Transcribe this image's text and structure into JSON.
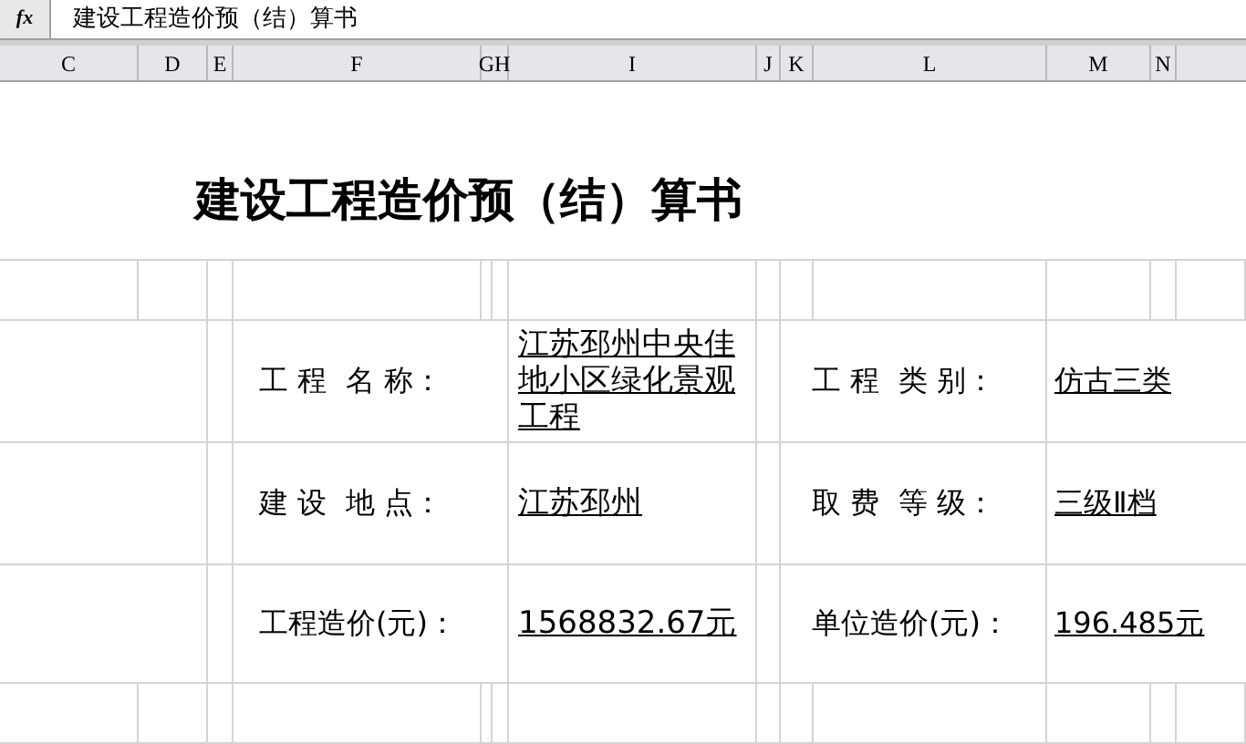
{
  "formula_bar": {
    "icon": "fx",
    "content": "建设工程造价预（结）算书"
  },
  "column_headers": [
    "C",
    "D",
    "E",
    "F",
    "GH",
    "I",
    "J",
    "K",
    "L",
    "M",
    "N"
  ],
  "title": "建设工程造价预（结）算书",
  "info_rows": [
    [
      {
        "label": "工 程  名 称：",
        "value": "江苏邳州中央佳地小区绿化景观工程"
      },
      {
        "label": "工 程  类 别：",
        "value": "仿古三类"
      }
    ],
    [
      {
        "label": "建 设  地 点：",
        "value": "江苏邳州"
      },
      {
        "label": "取 费  等 级：",
        "value": "三级Ⅱ档"
      }
    ],
    [
      {
        "label": "工程造价(元)：",
        "value": "1568832.67元"
      },
      {
        "label": "单位造价(元)：",
        "value": "196.485元"
      }
    ]
  ]
}
